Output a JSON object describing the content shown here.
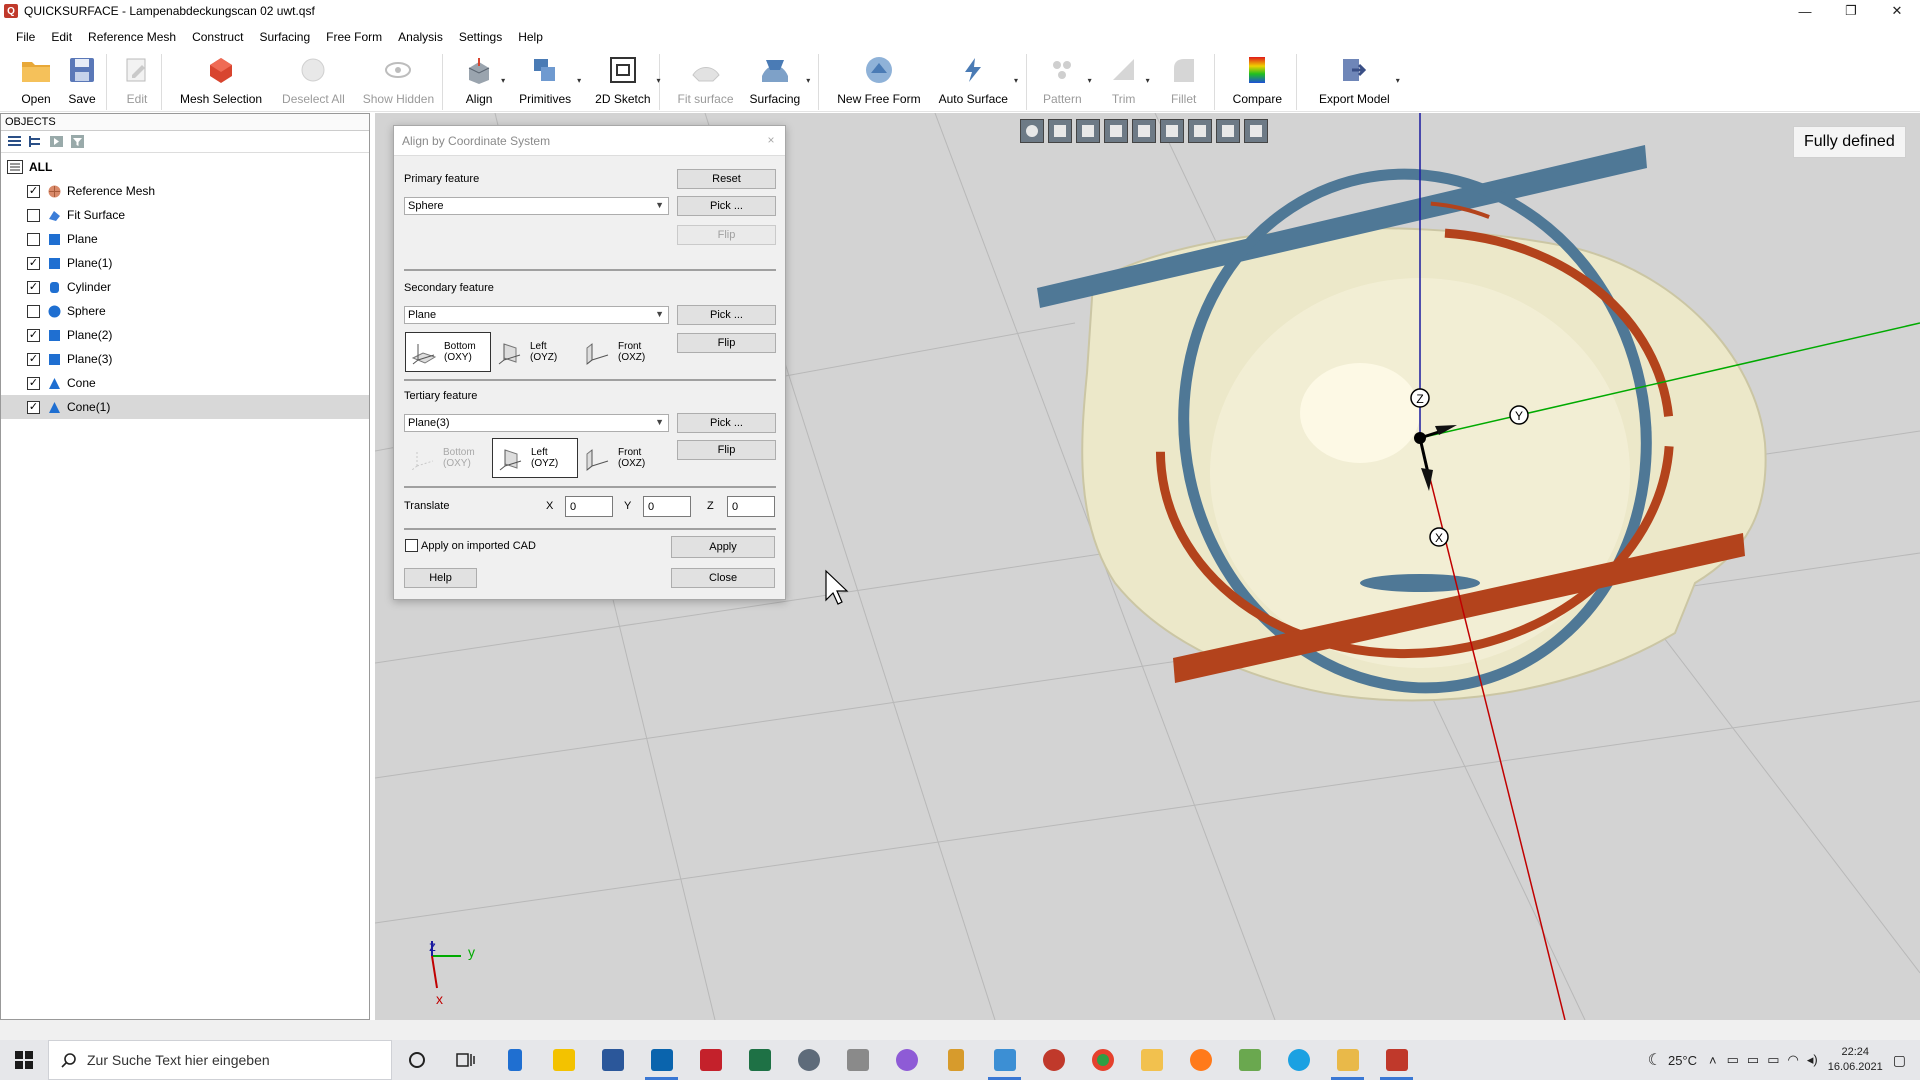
{
  "window": {
    "title": "QUICKSURFACE - Lampenabdeckungscan 02 uwt.qsf",
    "app_icon": "Q",
    "minimize": "—",
    "maximize": "❐",
    "close": "✕"
  },
  "menu": [
    "File",
    "Edit",
    "Reference Mesh",
    "Construct",
    "Surfacing",
    "Free Form",
    "Analysis",
    "Settings",
    "Help"
  ],
  "toolbar": {
    "open": "Open",
    "save": "Save",
    "edit": "Edit",
    "mesh_selection": "Mesh Selection",
    "deselect_all": "Deselect All",
    "show_hidden": "Show Hidden",
    "align": "Align",
    "primitives": "Primitives",
    "sketch2d": "2D Sketch",
    "fit_surface": "Fit surface",
    "surfacing": "Surfacing",
    "new_free_form": "New Free Form",
    "auto_surface": "Auto Surface",
    "pattern": "Pattern",
    "trim": "Trim",
    "fillet": "Fillet",
    "compare": "Compare",
    "export_model": "Export Model"
  },
  "objects_panel": {
    "header": "OBJECTS",
    "root": "ALL",
    "items": [
      {
        "label": "Reference Mesh",
        "checked": true,
        "icon": "mesh-icon"
      },
      {
        "label": "Fit Surface",
        "checked": false,
        "icon": "fit-surface-icon"
      },
      {
        "label": "Plane",
        "checked": false,
        "icon": "plane-icon"
      },
      {
        "label": "Plane(1)",
        "checked": true,
        "icon": "plane-icon"
      },
      {
        "label": "Cylinder",
        "checked": true,
        "icon": "cylinder-icon"
      },
      {
        "label": "Sphere",
        "checked": false,
        "icon": "sphere-icon"
      },
      {
        "label": "Plane(2)",
        "checked": true,
        "icon": "plane-icon"
      },
      {
        "label": "Plane(3)",
        "checked": true,
        "icon": "plane-icon"
      },
      {
        "label": "Cone",
        "checked": true,
        "icon": "cone-icon"
      },
      {
        "label": "Cone(1)",
        "checked": true,
        "icon": "cone-icon",
        "selected": true
      }
    ]
  },
  "dialog": {
    "title": "Align by Coordinate System",
    "close": "×",
    "primary_label": "Primary feature",
    "primary_value": "Sphere",
    "reset": "Reset",
    "pick": "Pick ...",
    "flip": "Flip",
    "secondary_label": "Secondary feature",
    "secondary_value": "Plane",
    "tertiary_label": "Tertiary feature",
    "tertiary_value": "Plane(3)",
    "opt_bottom": "Bottom",
    "opt_bottom_sub": "(OXY)",
    "opt_left": "Left",
    "opt_left_sub": "(OYZ)",
    "opt_front": "Front",
    "opt_front_sub": "(OXZ)",
    "translate_label": "Translate",
    "x_label": "X",
    "y_label": "Y",
    "z_label": "Z",
    "x_value": "0",
    "y_value": "0",
    "z_value": "0",
    "apply_cad": "Apply on imported CAD",
    "apply_cad_checked": false,
    "apply": "Apply",
    "help": "Help",
    "close_btn": "Close"
  },
  "viewport": {
    "status_badge": "Fully defined",
    "axis_x": "X",
    "axis_y": "Y",
    "axis_z": "Z",
    "mini_x": "x",
    "mini_y": "y",
    "mini_z": "z"
  },
  "taskbar": {
    "search_placeholder": "Zur Suche Text hier eingeben",
    "temperature": "25°C",
    "time": "22:24",
    "date": "16.06.2021"
  },
  "colors": {
    "accent": "#3a78d4",
    "mesh": "#e8e4c4",
    "brown_feature": "#b3431c",
    "blue_feature": "#4f7896",
    "axis_x": "#c00000",
    "axis_y": "#00aa00",
    "axis_z": "#1a1aa0"
  }
}
